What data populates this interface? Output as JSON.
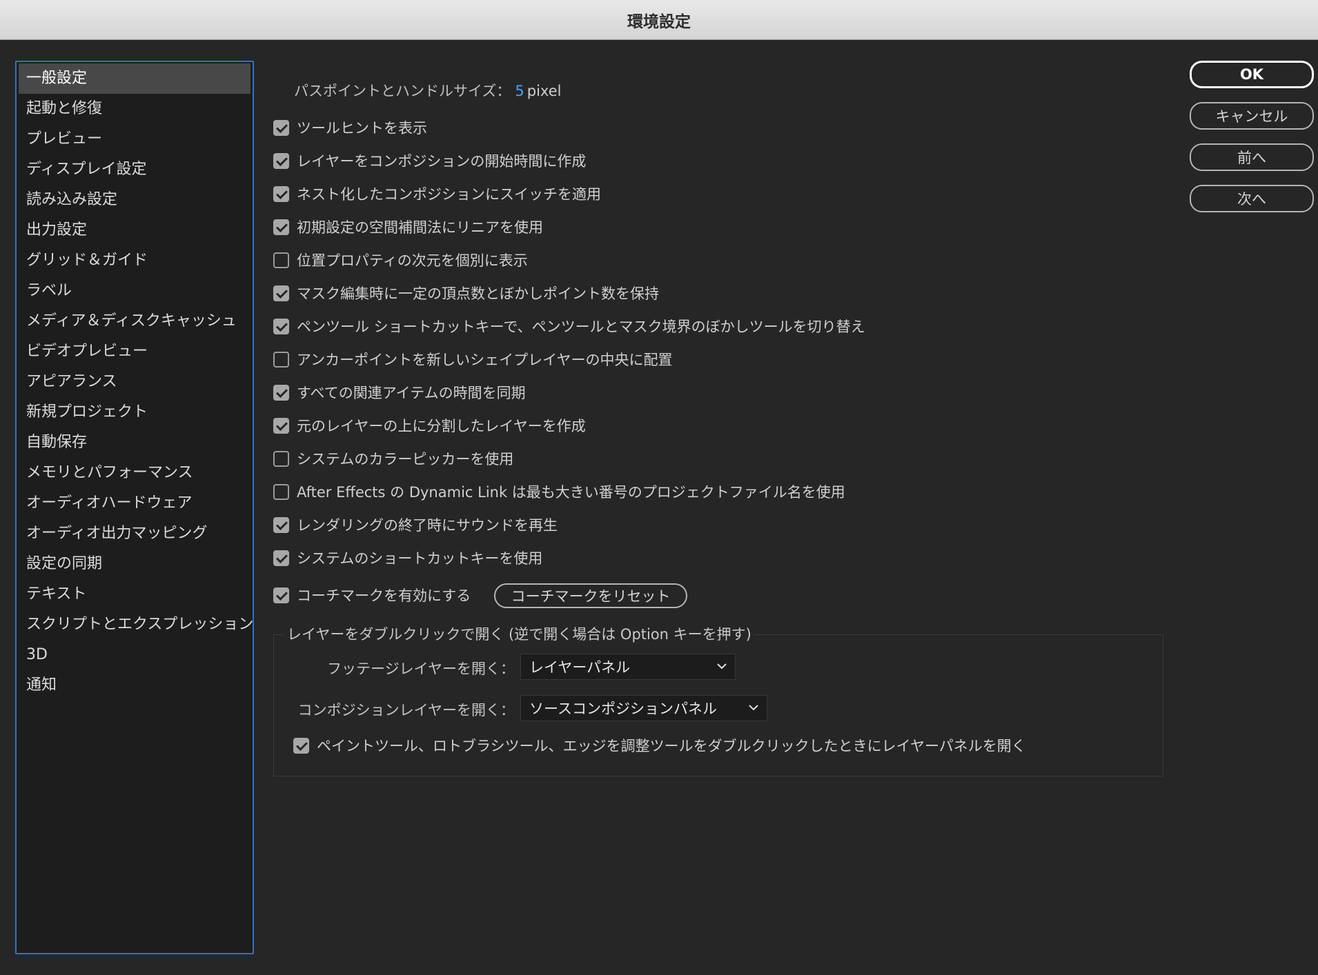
{
  "window": {
    "title": "環境設定"
  },
  "sidebar": {
    "items": [
      {
        "label": "一般設定",
        "selected": true
      },
      {
        "label": "起動と修復"
      },
      {
        "label": "プレビュー"
      },
      {
        "label": "ディスプレイ設定"
      },
      {
        "label": "読み込み設定"
      },
      {
        "label": "出力設定"
      },
      {
        "label": "グリッド＆ガイド"
      },
      {
        "label": "ラベル"
      },
      {
        "label": "メディア＆ディスクキャッシュ"
      },
      {
        "label": "ビデオプレビュー"
      },
      {
        "label": "アピアランス"
      },
      {
        "label": "新規プロジェクト"
      },
      {
        "label": "自動保存"
      },
      {
        "label": "メモリとパフォーマンス"
      },
      {
        "label": "オーディオハードウェア"
      },
      {
        "label": "オーディオ出力マッピング"
      },
      {
        "label": "設定の同期"
      },
      {
        "label": "テキスト"
      },
      {
        "label": "スクリプトとエクスプレッション"
      },
      {
        "label": "3D"
      },
      {
        "label": "通知"
      }
    ]
  },
  "buttons": {
    "ok": "OK",
    "cancel": "キャンセル",
    "prev": "前へ",
    "next": "次へ"
  },
  "general": {
    "path_point_label": "パスポイントとハンドルサイズ：",
    "path_point_value": "5",
    "path_point_unit": "pixel",
    "checkboxes": [
      {
        "label": "ツールヒントを表示",
        "checked": true
      },
      {
        "label": "レイヤーをコンポジションの開始時間に作成",
        "checked": true
      },
      {
        "label": "ネスト化したコンポジションにスイッチを適用",
        "checked": true
      },
      {
        "label": "初期設定の空間補間法にリニアを使用",
        "checked": true
      },
      {
        "label": "位置プロパティの次元を個別に表示",
        "checked": false
      },
      {
        "label": "マスク編集時に一定の頂点数とぼかしポイント数を保持",
        "checked": true
      },
      {
        "label": "ペンツール ショートカットキーで、ペンツールとマスク境界のぼかしツールを切り替え",
        "checked": true
      },
      {
        "label": "アンカーポイントを新しいシェイプレイヤーの中央に配置",
        "checked": false
      },
      {
        "label": "すべての関連アイテムの時間を同期",
        "checked": true
      },
      {
        "label": "元のレイヤーの上に分割したレイヤーを作成",
        "checked": true
      },
      {
        "label": "システムのカラーピッカーを使用",
        "checked": false
      },
      {
        "label": "After Effects の Dynamic Link は最も大きい番号のプロジェクトファイル名を使用",
        "checked": false
      },
      {
        "label": "レンダリングの終了時にサウンドを再生",
        "checked": true
      },
      {
        "label": "システムのショートカットキーを使用",
        "checked": true
      },
      {
        "label": "コーチマークを有効にする",
        "checked": true
      }
    ],
    "reset_coachmarks": "コーチマークをリセット"
  },
  "double_click_group": {
    "legend": "レイヤーをダブルクリックで開く (逆で開く場合は Option キーを押す)",
    "footage_label": "フッテージレイヤーを開く：",
    "footage_value": "レイヤーパネル",
    "comp_label": "コンポジションレイヤーを開く：",
    "comp_value": "ソースコンポジションパネル",
    "paint_checkbox": {
      "label": "ペイントツール、ロトブラシツール、エッジを調整ツールをダブルクリックしたときにレイヤーパネルを開く",
      "checked": true
    }
  }
}
